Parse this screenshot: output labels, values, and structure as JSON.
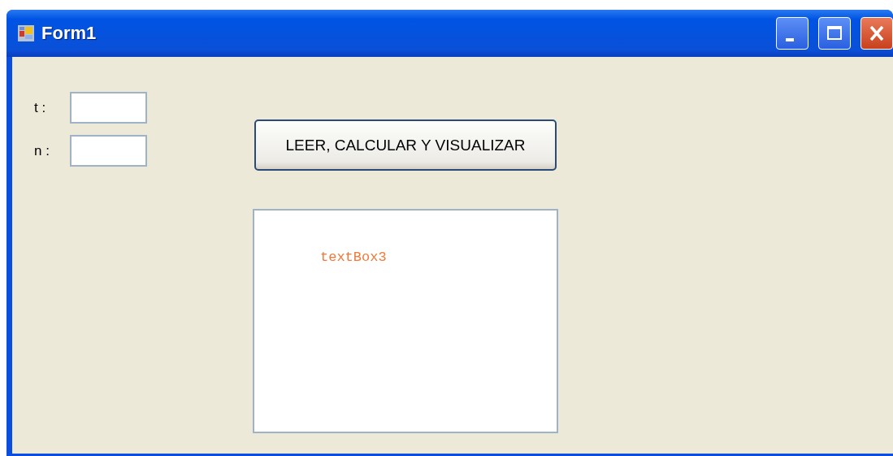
{
  "window": {
    "title": "Form1"
  },
  "fields": [
    {
      "label": "t :"
    },
    {
      "label": "n :"
    }
  ],
  "button": {
    "label": "LEER, CALCULAR Y VISUALIZAR"
  },
  "output": {
    "value": "textBox3"
  }
}
